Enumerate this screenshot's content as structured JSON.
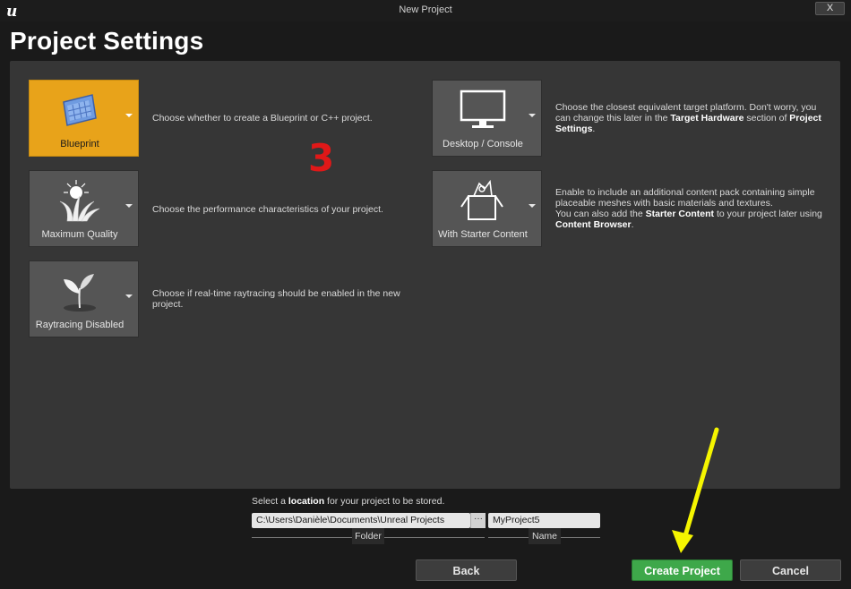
{
  "window": {
    "title": "New Project",
    "close_label": "X"
  },
  "page": {
    "title": "Project Settings"
  },
  "tiles": [
    {
      "label": "Blueprint",
      "description": "Choose whether to create a Blueprint or C++ project.",
      "icon": "blueprint-icon",
      "selected": true
    },
    {
      "label": "Maximum Quality",
      "description": "Choose the performance characteristics of your project.",
      "icon": "quality-icon",
      "selected": false
    },
    {
      "label": "Raytracing Disabled",
      "description": "Choose if real-time raytracing should be enabled in the new project.",
      "icon": "raytracing-icon",
      "selected": false
    },
    {
      "label": "Desktop / Console",
      "icon": "monitor-icon",
      "selected": false,
      "description": {
        "p1": "Choose the closest equivalent target platform. Don't worry, you can change this later in the ",
        "b1": "Target Hardware",
        "p2": " section of ",
        "b2": "Project Settings",
        "p3": "."
      }
    },
    {
      "label": "With Starter Content",
      "icon": "starter-content-icon",
      "selected": false,
      "description": {
        "p1": "Enable to include an additional content pack containing simple placeable meshes with basic materials and textures.",
        "p2": "You can also add the ",
        "b1": "Starter Content",
        "p3": " to your project later using ",
        "b2": "Content Browser",
        "p4": "."
      }
    }
  ],
  "annotation": {
    "number": "3",
    "color": "#e01818",
    "arrow_color": "#f5f500"
  },
  "location": {
    "prompt_pre": "Select a ",
    "prompt_bold": "location",
    "prompt_post": " for your project to be stored.",
    "folder_value": "C:\\Users\\Danièle\\Documents\\Unreal Projects",
    "browse_label": "···",
    "name_value": "MyProject5",
    "folder_label": "Folder",
    "name_label": "Name"
  },
  "buttons": {
    "back": "Back",
    "create": "Create Project",
    "cancel": "Cancel"
  },
  "colors": {
    "selected_tile": "#e8a31a",
    "create_button": "#3ea84a",
    "panel": "#363636"
  }
}
